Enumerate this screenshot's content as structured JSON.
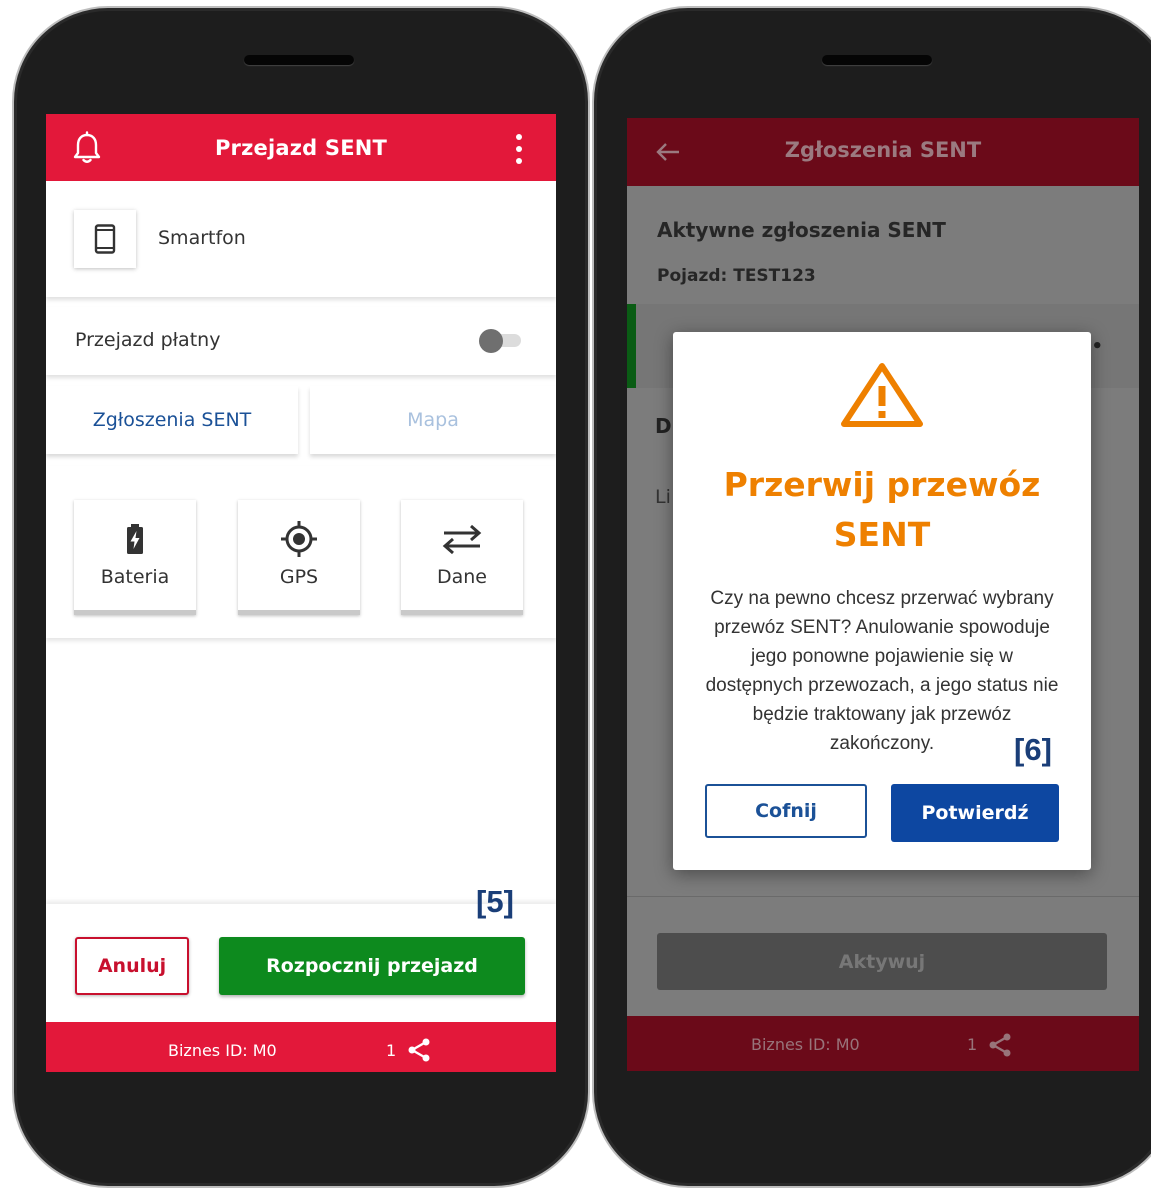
{
  "left": {
    "appbar": {
      "title": "Przejazd SENT"
    },
    "device": {
      "label": "Smartfon"
    },
    "toll": {
      "label": "Przejazd płatny",
      "enabled": false
    },
    "tabs": [
      {
        "label": "Zgłoszenia SENT"
      },
      {
        "label": "Mapa"
      }
    ],
    "tiles": [
      {
        "label": "Bateria",
        "icon": "battery-icon"
      },
      {
        "label": "GPS",
        "icon": "gps-icon"
      },
      {
        "label": "Dane",
        "icon": "data-transfer-icon"
      }
    ],
    "actions": {
      "cancel": "Anuluj",
      "start": "Rozpocznij przejazd"
    },
    "footer": {
      "biz": "Biznes ID:  M0",
      "count": "1"
    },
    "step": "[5]"
  },
  "right": {
    "appbar": {
      "title": "Zgłoszenia SENT"
    },
    "heading": "Aktywne zgłoszenia SENT",
    "vehicle": "Pojazd: TEST123",
    "partial_d": "D",
    "partial_li": "Li",
    "activate": "Aktywuj",
    "footer": {
      "biz": "Biznes ID:  M0",
      "count": "1"
    },
    "dialog": {
      "title_line1": "Przerwij przewóz",
      "title_line2": "SENT",
      "body": "Czy na pewno chcesz przerwać wybrany przewóz SENT? Anulowanie spowoduje jego ponowne pojawienie się w dostępnych przewozach, a jego status nie będzie traktowany jak przewóz zakończony.",
      "back": "Cofnij",
      "confirm": "Potwierdź"
    },
    "step": "[6]"
  },
  "colors": {
    "brand_red": "#e3183a",
    "start_green": "#0d8a1e",
    "confirm_blue": "#0d47a1",
    "warning_orange": "#ee8000"
  }
}
